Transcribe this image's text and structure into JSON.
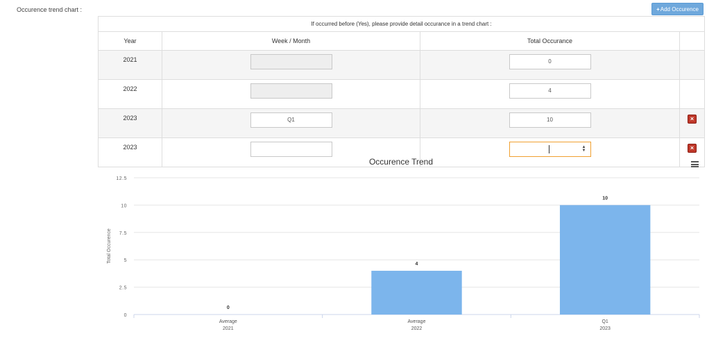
{
  "form": {
    "field_label": "Occurence trend chart :",
    "add_button_label": "Add Occurence",
    "add_button_icon": "plus-icon"
  },
  "table": {
    "caption": "If occurred before (Yes), please provide detail occurance in a trend chart :",
    "headers": [
      "Year",
      "Week / Month",
      "Total Occurance",
      ""
    ],
    "rows": [
      {
        "year": "2021",
        "period": "",
        "period_disabled": true,
        "total": "0",
        "deletable": false
      },
      {
        "year": "2022",
        "period": "",
        "period_disabled": true,
        "total": "4",
        "deletable": false
      },
      {
        "year": "2023",
        "period": "Q1",
        "period_disabled": false,
        "total": "10",
        "deletable": true
      },
      {
        "year": "2023",
        "period": "",
        "period_disabled": false,
        "total": "",
        "deletable": true,
        "focused": true
      }
    ]
  },
  "chart_data": {
    "type": "bar",
    "title": "Occurence Trend",
    "ylabel": "Total Occurence",
    "xlabel": "",
    "categories": [
      {
        "label": "Average",
        "sublabel": "2021"
      },
      {
        "label": "Average",
        "sublabel": "2022"
      },
      {
        "label": "Q1",
        "sublabel": "2023"
      }
    ],
    "values": [
      0,
      4,
      10
    ],
    "ylim": [
      0,
      12.5
    ],
    "yticks": [
      0,
      2.5,
      5,
      7.5,
      10,
      12.5
    ],
    "ytick_labels": [
      "0",
      "2.5",
      "5",
      "7.5",
      "10",
      "12.5"
    ],
    "bar_color": "#7cb5ec",
    "grid": true,
    "legend": "none",
    "menu_icon": "hamburger-menu-icon"
  }
}
